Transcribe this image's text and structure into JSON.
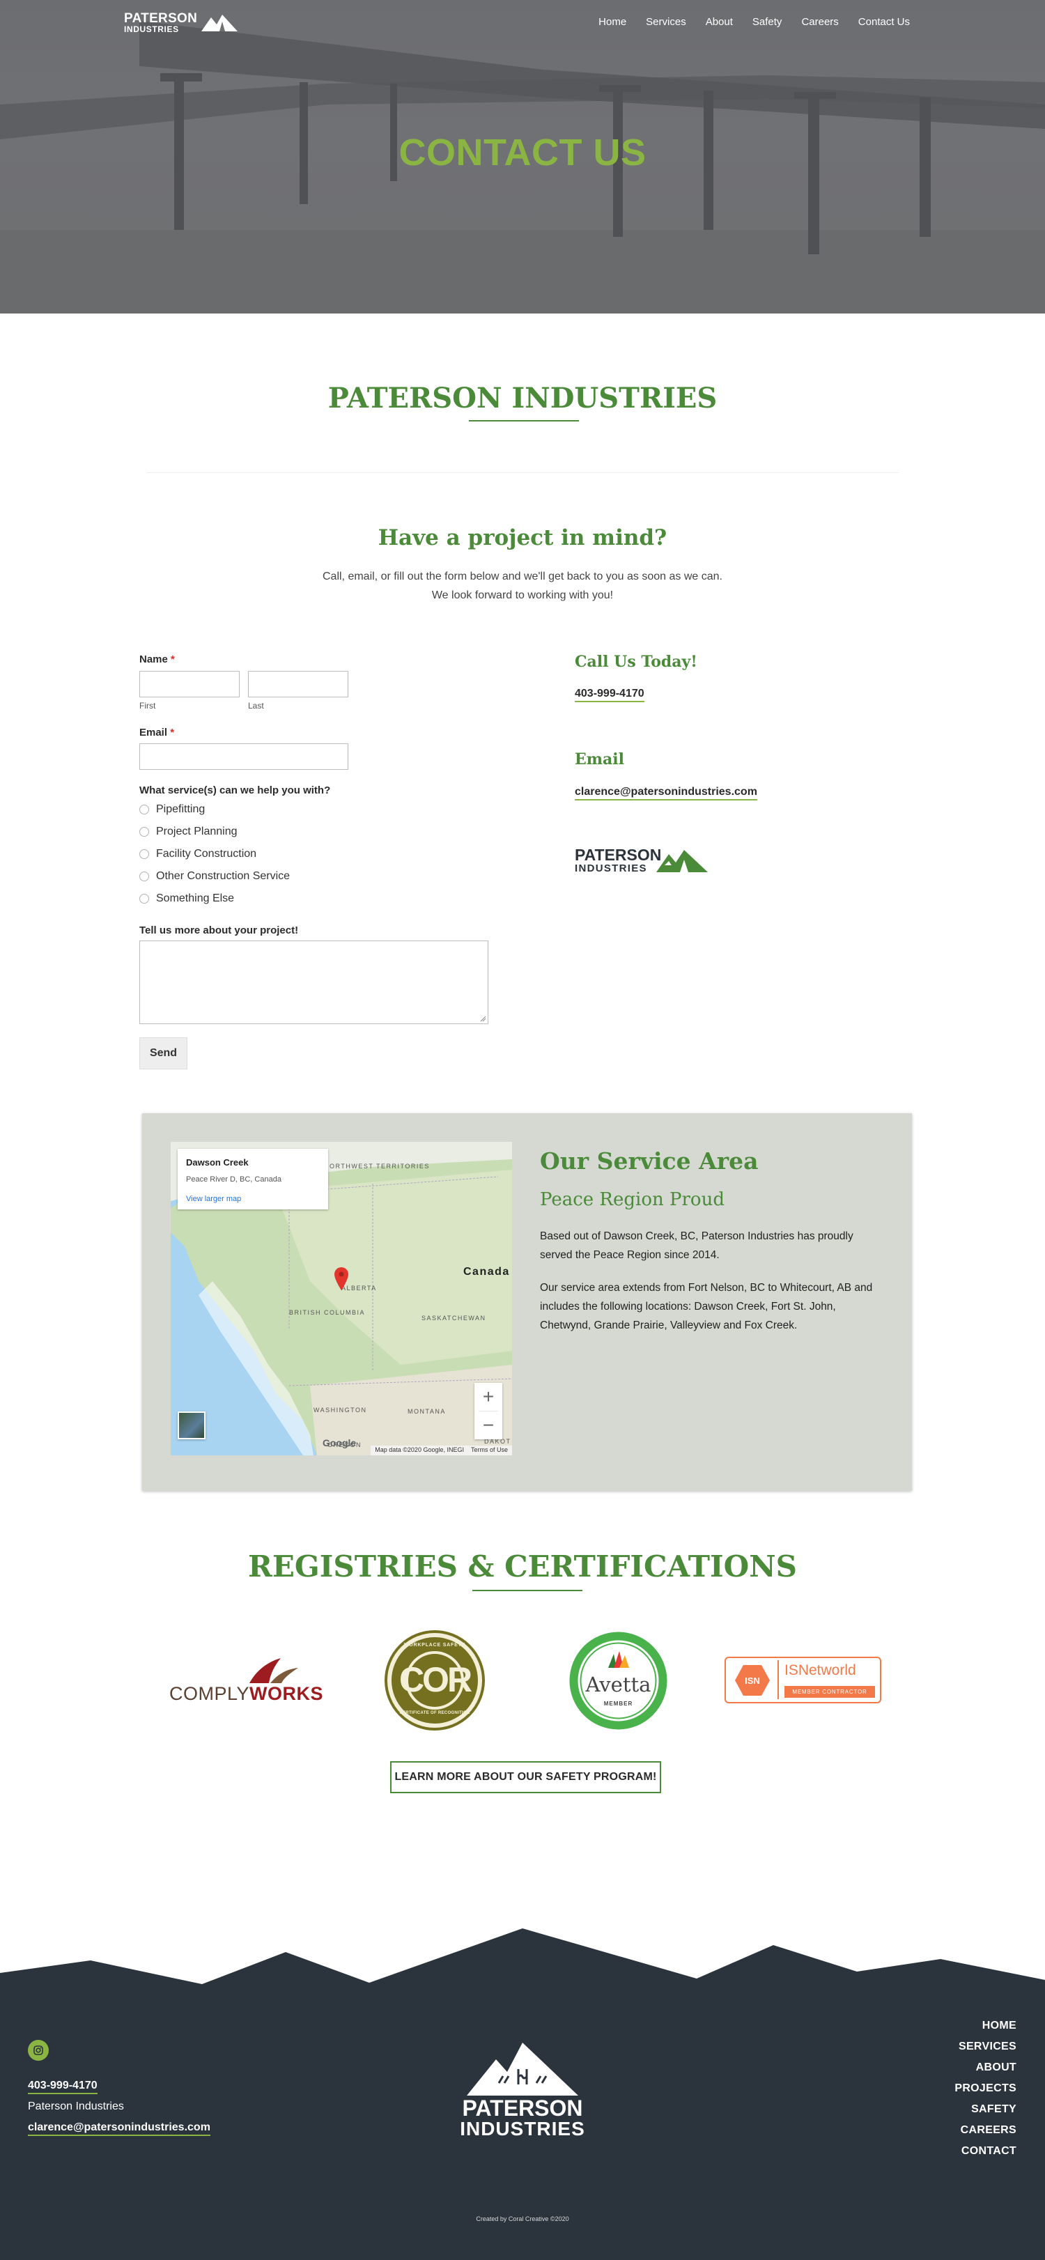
{
  "header": {
    "logo_line1": "PATERSON",
    "logo_line2": "INDUSTRIES",
    "nav": [
      "Home",
      "Services",
      "About",
      "Safety",
      "Careers",
      "Contact Us"
    ]
  },
  "hero": {
    "title": "CONTACT US"
  },
  "intro": {
    "company_title": "PATERSON INDUSTRIES",
    "project_heading": "Have a project in mind?",
    "project_text": "Call, email, or fill out the form below and we'll get back to you as soon as we can. We look forward to working with you!"
  },
  "form": {
    "name_label": "Name",
    "required_mark": "*",
    "first_label": "First",
    "last_label": "Last",
    "email_label": "Email",
    "services_label": "What service(s) can we help you with?",
    "services": [
      "Pipefitting",
      "Project Planning",
      "Facility Construction",
      "Other Construction Service",
      "Something Else"
    ],
    "project_label": "Tell us more about your project!",
    "send_label": "Send"
  },
  "contact": {
    "call_heading": "Call Us Today!",
    "phone": "403-999-4170",
    "email_heading": "Email",
    "email": "clarence@patersonindustries.com",
    "logo_line1": "PATERSON",
    "logo_line2": "INDUSTRIES"
  },
  "service_area": {
    "map_card_title": "Dawson Creek",
    "map_card_subtitle": "Peace River D, BC, Canada",
    "map_card_link": "View larger map",
    "map_labels": {
      "canada": "Canada",
      "nwt": "NORTHWEST TERRITORIES",
      "alberta": "ALBERTA",
      "bc": "BRITISH COLUMBIA",
      "sask": "SASKATCHEWAN",
      "washington": "WASHINGTON",
      "montana": "MONTANA",
      "oregon": "OREGON",
      "dakota": "DAKOT"
    },
    "zoom_in": "+",
    "zoom_out": "−",
    "google": "Google",
    "map_data": "Map data ©2020 Google, INEGI",
    "terms": "Terms of Use",
    "heading": "Our Service Area",
    "subheading": "Peace Region Proud",
    "paragraph1": "Based out of Dawson Creek, BC, Paterson Industries has proudly served the Peace Region since 2014.",
    "paragraph2": "Our service area extends from Fort Nelson, BC to Whitecourt, AB and includes the following locations: Dawson Creek, Fort St. John, Chetwynd, Grande Prairie, Valleyview and Fox Creek."
  },
  "registries": {
    "title": "REGISTRIES & CERTIFICATIONS",
    "complyworks_a": "COMPLY",
    "complyworks_b": "WORKS",
    "cor": "COR",
    "cor_ring_top": "WORKPLACE SAFETY",
    "cor_ring_bottom": "CERTIFICATE OF RECOGNITION",
    "avetta": "Avetta",
    "avetta_member": "MEMBER",
    "isn_badge": "ISN",
    "isn_name": "ISNetworld",
    "isn_member": "MEMBER CONTRACTOR",
    "cta_label": "LEARN MORE ABOUT OUR SAFETY PROGRAM!"
  },
  "footer": {
    "phone": "403-999-4170",
    "company": "Paterson Industries",
    "email": "clarence@patersonindustries.com",
    "logo_line1": "PATERSON",
    "logo_line2": "INDUSTRIES",
    "nav": [
      "HOME",
      "SERVICES",
      "ABOUT",
      "PROJECTS",
      "SAFETY",
      "CAREERS",
      "CONTACT"
    ],
    "credit": "Created by Coral Creative ©2020"
  },
  "colors": {
    "brand_green": "#4a8a39",
    "accent_lime": "#8bb543",
    "footer_dark": "#2b333d",
    "service_bg": "#d5d9d2"
  }
}
